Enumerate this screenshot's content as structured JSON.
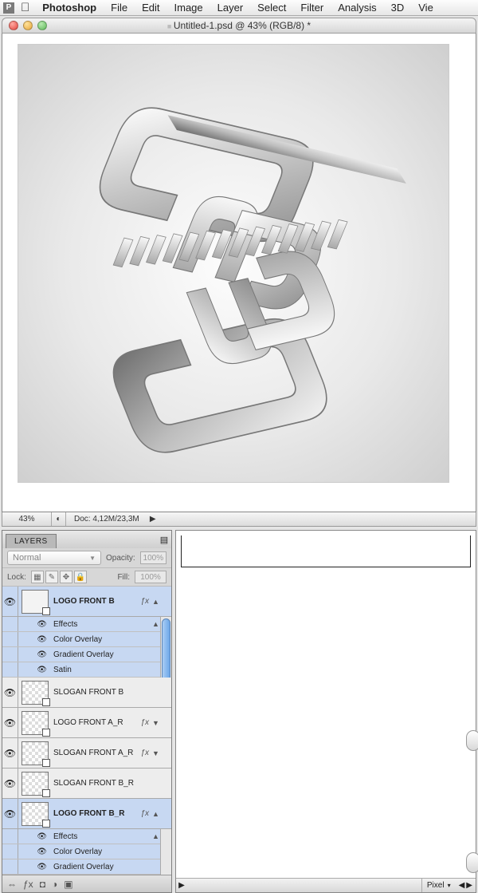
{
  "menubar": {
    "app_letter": "P",
    "items": [
      "Photoshop",
      "File",
      "Edit",
      "Image",
      "Layer",
      "Select",
      "Filter",
      "Analysis",
      "3D",
      "Vie"
    ]
  },
  "document": {
    "title": "Untitled-1.psd @ 43% (RGB/8) *",
    "zoom": "43%",
    "doc_info": "Doc: 4,12M/23,3M"
  },
  "layers_panel": {
    "tab": "LAYERS",
    "blend_mode": "Normal",
    "opacity_label": "Opacity:",
    "opacity_value": "100%",
    "lock_label": "Lock:",
    "fill_label": "Fill:",
    "fill_value": "100%",
    "effects_label": "Effects",
    "layers": [
      {
        "name": "LOGO FRONT B",
        "selected": true,
        "bold": true,
        "fx": true,
        "expanded": true,
        "solidThumb": true,
        "effects": [
          "Color Overlay",
          "Gradient Overlay",
          "Satin"
        ]
      },
      {
        "name": "SLOGAN FRONT B",
        "selected": false,
        "bold": false,
        "fx": false,
        "expanded": false
      },
      {
        "name": "LOGO FRONT A_R",
        "selected": false,
        "bold": false,
        "fx": true,
        "expanded": false
      },
      {
        "name": "SLOGAN FRONT A_R",
        "selected": false,
        "bold": false,
        "fx": true,
        "expanded": false
      },
      {
        "name": "SLOGAN FRONT B_R",
        "selected": false,
        "bold": false,
        "fx": false,
        "expanded": false
      },
      {
        "name": "LOGO FRONT B_R",
        "selected": true,
        "bold": true,
        "fx": true,
        "expanded": true,
        "effects": [
          "Color Overlay",
          "Gradient Overlay"
        ]
      }
    ]
  },
  "bottom_status": {
    "pixel_label": "Pixel"
  }
}
